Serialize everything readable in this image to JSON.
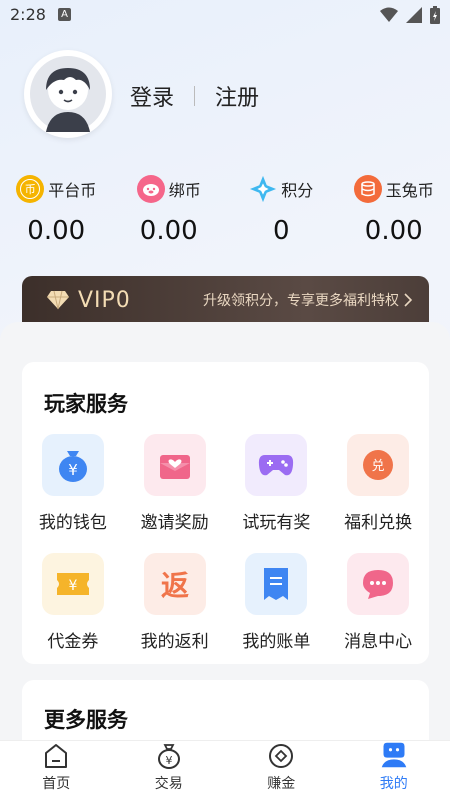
{
  "status_bar": {
    "time": "2:28",
    "notif_letter": "A"
  },
  "auth": {
    "login": "登录",
    "register": "注册"
  },
  "currencies": [
    {
      "label": "平台币",
      "value": "0.00",
      "icon": "币",
      "icon_name": "platform-coin-icon",
      "color": "#f5b400"
    },
    {
      "label": "绑币",
      "value": "0.00",
      "icon": "pig",
      "icon_name": "bind-coin-icon",
      "color": "#f5668a"
    },
    {
      "label": "积分",
      "value": "0",
      "icon": "star",
      "icon_name": "points-icon",
      "color": "#3fb8f0"
    },
    {
      "label": "玉兔币",
      "value": "0.00",
      "icon": "stack",
      "icon_name": "jade-rabbit-coin-icon",
      "color": "#f36b3b"
    }
  ],
  "vip": {
    "level": "VIP0",
    "desc": "升级领积分，专享更多福利特权"
  },
  "player_services": {
    "title": "玩家服务",
    "items": [
      {
        "label": "我的钱包",
        "icon_name": "wallet-icon",
        "bg": "#e6f1fd",
        "fg": "#3f86f2"
      },
      {
        "label": "邀请奖励",
        "icon_name": "invite-reward-icon",
        "bg": "#fde9ee",
        "fg": "#f0668a"
      },
      {
        "label": "试玩有奖",
        "icon_name": "trial-game-icon",
        "bg": "#f1ebfd",
        "fg": "#9b6cf2"
      },
      {
        "label": "福利兑换",
        "icon_name": "welfare-exchange-icon",
        "bg": "#fdece6",
        "fg": "#f0744a"
      },
      {
        "label": "代金券",
        "icon_name": "voucher-icon",
        "bg": "#fdf4e0",
        "fg": "#f5b42a"
      },
      {
        "label": "我的返利",
        "icon_name": "rebate-icon",
        "bg": "#fdece6",
        "fg": "#f0744a"
      },
      {
        "label": "我的账单",
        "icon_name": "bill-icon",
        "bg": "#e6f1fd",
        "fg": "#3f86f2"
      },
      {
        "label": "消息中心",
        "icon_name": "message-icon",
        "bg": "#fde9ee",
        "fg": "#f0668a"
      }
    ]
  },
  "more_services": {
    "title": "更多服务"
  },
  "tabs": [
    {
      "label": "首页",
      "icon_name": "home-tab-icon",
      "active": false
    },
    {
      "label": "交易",
      "icon_name": "trade-tab-icon",
      "active": false
    },
    {
      "label": "赚金",
      "icon_name": "earn-tab-icon",
      "active": false
    },
    {
      "label": "我的",
      "icon_name": "mine-tab-icon",
      "active": true
    }
  ],
  "colors": {
    "accent": "#2e7bf6",
    "vip_gold": "#f3dcb4"
  }
}
